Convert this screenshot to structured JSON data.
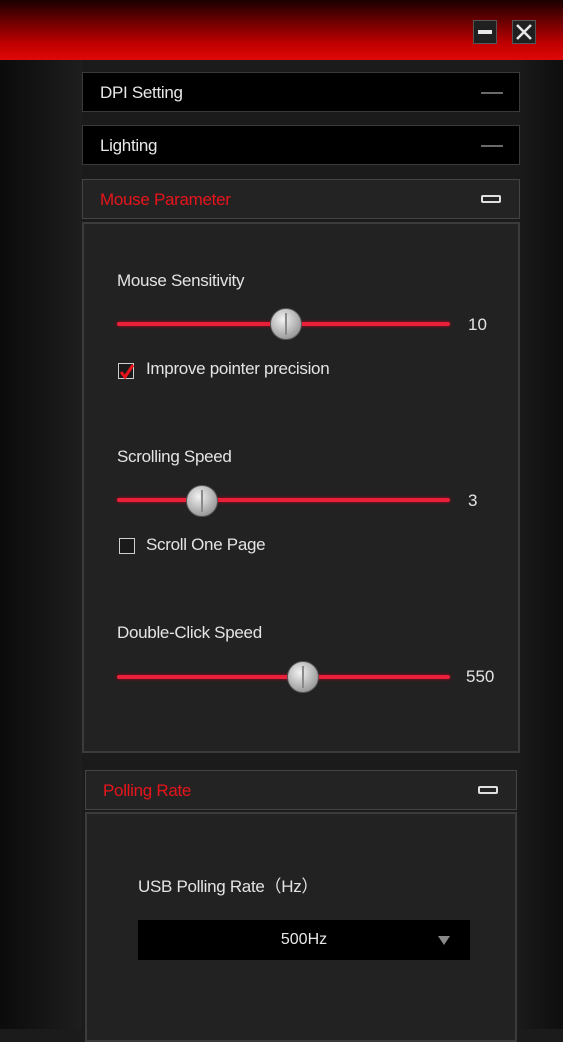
{
  "window": {
    "minimize_label": "minimize",
    "close_label": "close"
  },
  "sections": {
    "dpi": {
      "label": "DPI Setting"
    },
    "lighting": {
      "label": "Lighting"
    },
    "mouse_parameter": {
      "label": "Mouse Parameter"
    },
    "polling_rate": {
      "label": "Polling Rate"
    }
  },
  "mouse_parameter": {
    "sensitivity": {
      "label": "Mouse Sensitivity",
      "value": "10",
      "fraction": 0.51
    },
    "improve_precision": {
      "label": "Improve pointer precision",
      "checked": true
    },
    "scrolling": {
      "label": "Scrolling Speed",
      "value": "3",
      "fraction": 0.25
    },
    "scroll_one_page": {
      "label": "Scroll One Page",
      "checked": false
    },
    "double_click": {
      "label": "Double-Click Speed",
      "value": "550",
      "fraction": 0.56
    }
  },
  "polling": {
    "label": "USB Polling Rate（Hz）",
    "selected": "500Hz"
  },
  "colors": {
    "accent": "#e8141c",
    "slider": "#e8203a",
    "background": "#222222"
  }
}
